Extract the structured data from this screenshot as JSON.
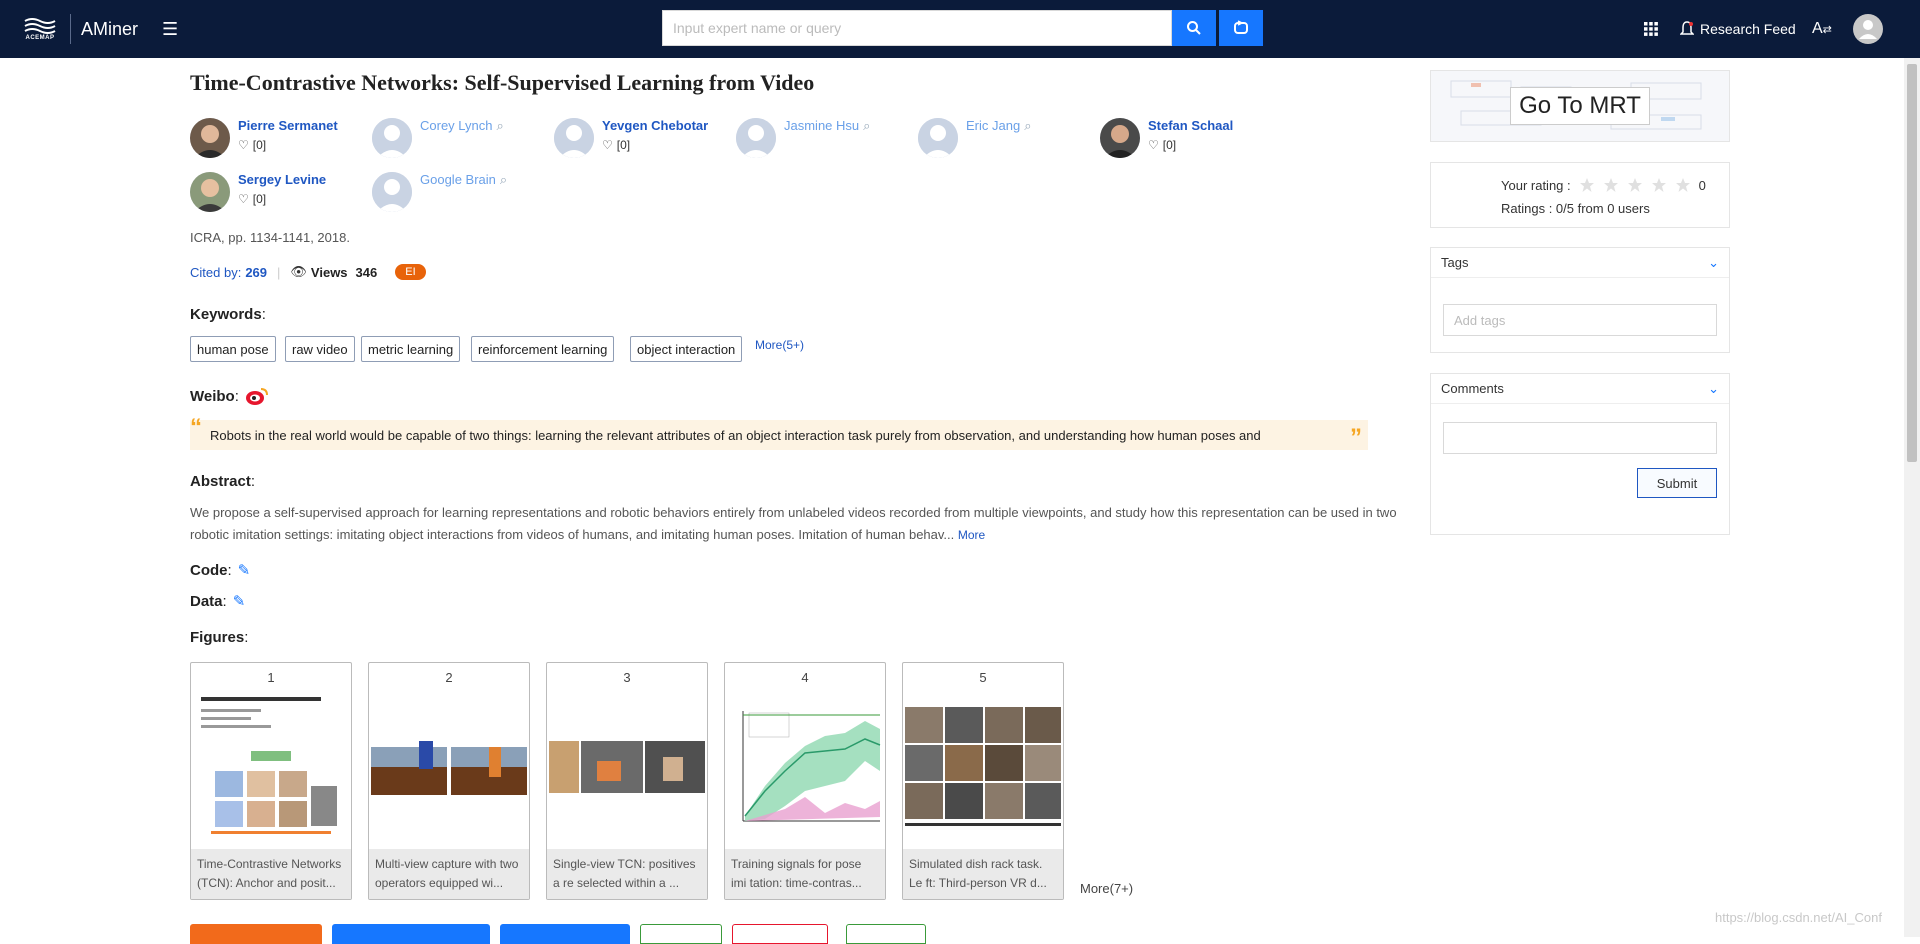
{
  "header": {
    "logo_org": "ACEMAP",
    "logo_app": "AMiner",
    "search_placeholder": "Input expert name or query",
    "research_feed": "Research Feed"
  },
  "paper": {
    "title": "Time-Contrastive Networks: Self-Supervised Learning from Video",
    "venue": "ICRA, pp. 1134-1141, 2018.",
    "cited_label": "Cited by:",
    "cited_count": "269",
    "views_label": "Views",
    "views_count": "346",
    "badge": "EI"
  },
  "authors": [
    {
      "name": "Pierre Sermanet",
      "likes": "[0]",
      "linked": true
    },
    {
      "name": "Corey Lynch",
      "likes": "",
      "linked": false
    },
    {
      "name": "Yevgen Chebotar",
      "likes": "[0]",
      "linked": true
    },
    {
      "name": "Jasmine Hsu",
      "likes": "",
      "linked": false
    },
    {
      "name": "Eric Jang",
      "likes": "",
      "linked": false
    },
    {
      "name": "Stefan Schaal",
      "likes": "[0]",
      "linked": true
    },
    {
      "name": "Sergey Levine",
      "likes": "[0]",
      "linked": true
    },
    {
      "name": "Google Brain",
      "likes": "",
      "linked": false
    }
  ],
  "keywords": {
    "heading": "Keywords",
    "items": [
      "human pose",
      "raw video",
      "metric learning",
      "reinforcement learning",
      "object interaction"
    ],
    "more": "More(5+)"
  },
  "weibo": {
    "heading": "Weibo",
    "text": "Robots in the real world would be capable of two things: learning the relevant attributes of an object interaction task purely from observation, and understanding how human poses and"
  },
  "abstract": {
    "heading": "Abstract",
    "text": "We propose a self-supervised approach for learning representations and robotic behaviors entirely from unlabeled videos recorded from multiple viewpoints, and study how this representation can be used in two robotic imitation settings: imitating object interactions from videos of humans, and imitating human poses. Imitation of human behav...",
    "more": "More"
  },
  "code_label": "Code",
  "data_label": "Data",
  "figures": {
    "heading": "Figures",
    "items": [
      {
        "num": "1",
        "caption": "Time-Contrastive Networks (TCN): Anchor and posit..."
      },
      {
        "num": "2",
        "caption": "Multi-view capture with two operators equipped wi..."
      },
      {
        "num": "3",
        "caption": "Single-view TCN: positives a re selected within a ..."
      },
      {
        "num": "4",
        "caption": "Training signals for pose imi tation: time-contras..."
      },
      {
        "num": "5",
        "caption": "Simulated dish rack task. Le ft: Third-person VR d..."
      }
    ],
    "more": "More(7+)"
  },
  "sidebar": {
    "mrt_button": "Go To MRT",
    "rating_label": "Your rating :",
    "rating_value": "0",
    "ratings_summary": "Ratings : 0/5 from 0 users",
    "tags_title": "Tags",
    "tags_placeholder": "Add tags",
    "comments_title": "Comments",
    "submit": "Submit"
  },
  "watermark": "https://blog.csdn.net/AI_Conf",
  "colors": {
    "topbar": "#0b1b3a",
    "accent_blue": "#1677ff",
    "link_blue": "#1f57c2",
    "ei_badge": "#e8630a"
  }
}
